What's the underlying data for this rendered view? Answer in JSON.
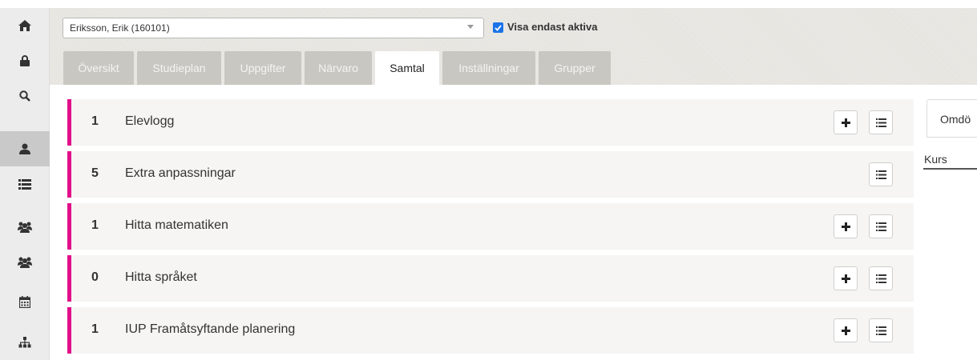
{
  "sidebar": {
    "items": [
      {
        "icon": "home-icon"
      },
      {
        "icon": "lock-icon"
      },
      {
        "icon": "search-icon"
      },
      {
        "icon": "user-icon",
        "active": true
      },
      {
        "icon": "list-icon"
      },
      {
        "icon": "group-icon"
      },
      {
        "icon": "group-alt-icon"
      },
      {
        "icon": "calendar-icon"
      },
      {
        "icon": "sitemap-icon"
      }
    ]
  },
  "header": {
    "student_select_value": "Eriksson, Erik (160101)",
    "active_only_label": "Visa endast aktiva",
    "active_only_checked": true
  },
  "tabs": [
    {
      "label": "Översikt"
    },
    {
      "label": "Studieplan"
    },
    {
      "label": "Uppgifter"
    },
    {
      "label": "Närvaro"
    },
    {
      "label": "Samtal",
      "active": true
    },
    {
      "label": "Inställningar"
    },
    {
      "label": "Grupper"
    }
  ],
  "rows": [
    {
      "count": "1",
      "title": "Elevlogg",
      "has_add": true
    },
    {
      "count": "5",
      "title": "Extra anpassningar",
      "has_add": false
    },
    {
      "count": "1",
      "title": "Hitta matematiken",
      "has_add": true
    },
    {
      "count": "0",
      "title": "Hitta språket",
      "has_add": true
    },
    {
      "count": "1",
      "title": "IUP Framåtsyftande planering",
      "has_add": true
    }
  ],
  "right_panel": {
    "tab_label": "Omdö",
    "kurs_label": "Kurs"
  },
  "colors": {
    "accent_bar": "#e10f8a",
    "checkbox": "#1a73e8"
  }
}
